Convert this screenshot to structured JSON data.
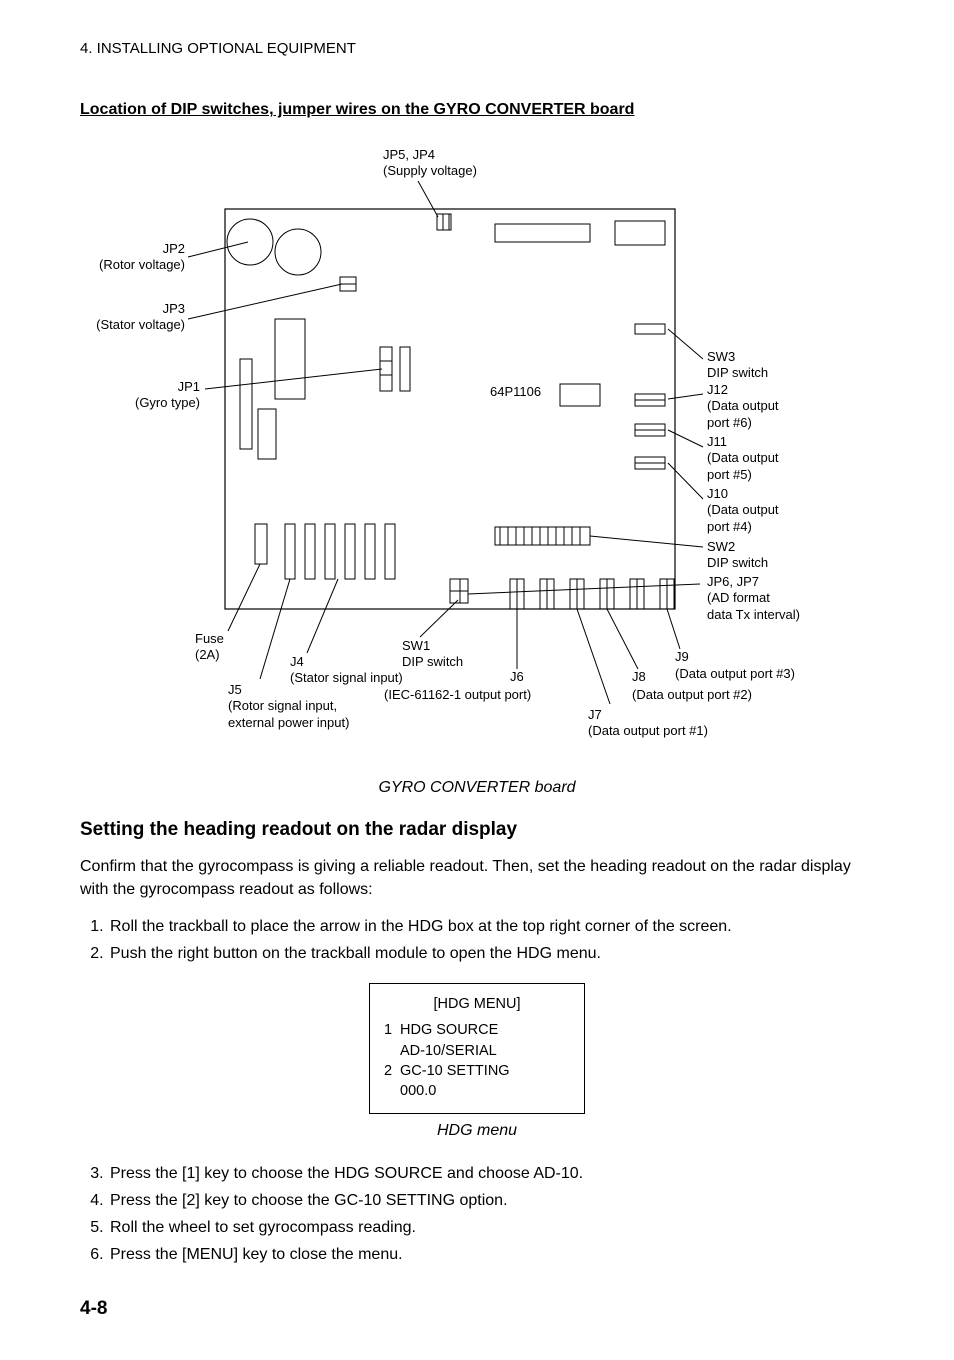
{
  "header": "4. INSTALLING OPTIONAL EQUIPMENT",
  "section_title": "Location of DIP switches, jumper wires on the GYRO CONVERTER board",
  "diagram": {
    "top_label_l1": "JP5, JP4",
    "top_label_l2": "(Supply voltage)",
    "jp2_l1": "JP2",
    "jp2_l2": "(Rotor voltage)",
    "jp3_l1": "JP3",
    "jp3_l2": "(Stator voltage)",
    "jp1_l1": "JP1",
    "jp1_l2": "(Gyro type)",
    "part": "64P1106",
    "sw3_l1": "SW3",
    "sw3_l2": "DIP switch",
    "j12_l1": "J12",
    "j12_l2": "(Data output",
    "j12_l3": "port #6)",
    "j11_l1": "J11",
    "j11_l2": "(Data output",
    "j11_l3": "port #5)",
    "j10_l1": "J10",
    "j10_l2": "(Data output",
    "j10_l3": "port #4)",
    "sw2_l1": "SW2",
    "sw2_l2": "DIP switch",
    "jp67_l1": "JP6, JP7",
    "jp67_l2": "(AD format",
    "jp67_l3": "data Tx interval)",
    "fuse_l1": "Fuse",
    "fuse_l2": "(2A)",
    "j4_l1": "J4",
    "j4_l2": "(Stator signal input)",
    "sw1_l1": "SW1",
    "sw1_l2": "DIP switch",
    "j5_l1": "J5",
    "j5_l2": "(Rotor signal input,",
    "j5_l3": "external power input)",
    "j6_l1": "J6",
    "j6_l2": "(IEC-61162-1 output port)",
    "j7_l1": "J7",
    "j7_l2": "(Data output port #1)",
    "j8_l1": "J8",
    "j8_l2": "(Data output port #2)",
    "j9_l1": "J9",
    "j9_l2": "(Data output port #3)"
  },
  "caption1": "GYRO CONVERTER board",
  "subheading": "Setting the heading readout on the radar display",
  "para": "Confirm that the gyrocompass is giving a reliable readout. Then, set the heading readout on the radar display with the gyrocompass readout as follows:",
  "steps12": {
    "s1": "Roll the trackball to place the arrow in the HDG box at the top right corner of the screen.",
    "s2": "Push the right button on the trackball module to open the HDG menu."
  },
  "menu": {
    "title": "[HDG MENU]",
    "r1n": "1",
    "r1": "HDG SOURCE",
    "r1b": "AD-10/SERIAL",
    "r2n": "2",
    "r2": "GC-10 SETTING",
    "r2b": "000.0"
  },
  "caption2": "HDG menu",
  "steps3456": {
    "s3": "Press the [1] key to choose the HDG SOURCE and choose AD-10.",
    "s4": "Press the [2] key to choose the GC-10 SETTING option.",
    "s5": "Roll the wheel to set gyrocompass reading.",
    "s6": "Press the [MENU] key to close the menu."
  },
  "page_num": "4-8"
}
